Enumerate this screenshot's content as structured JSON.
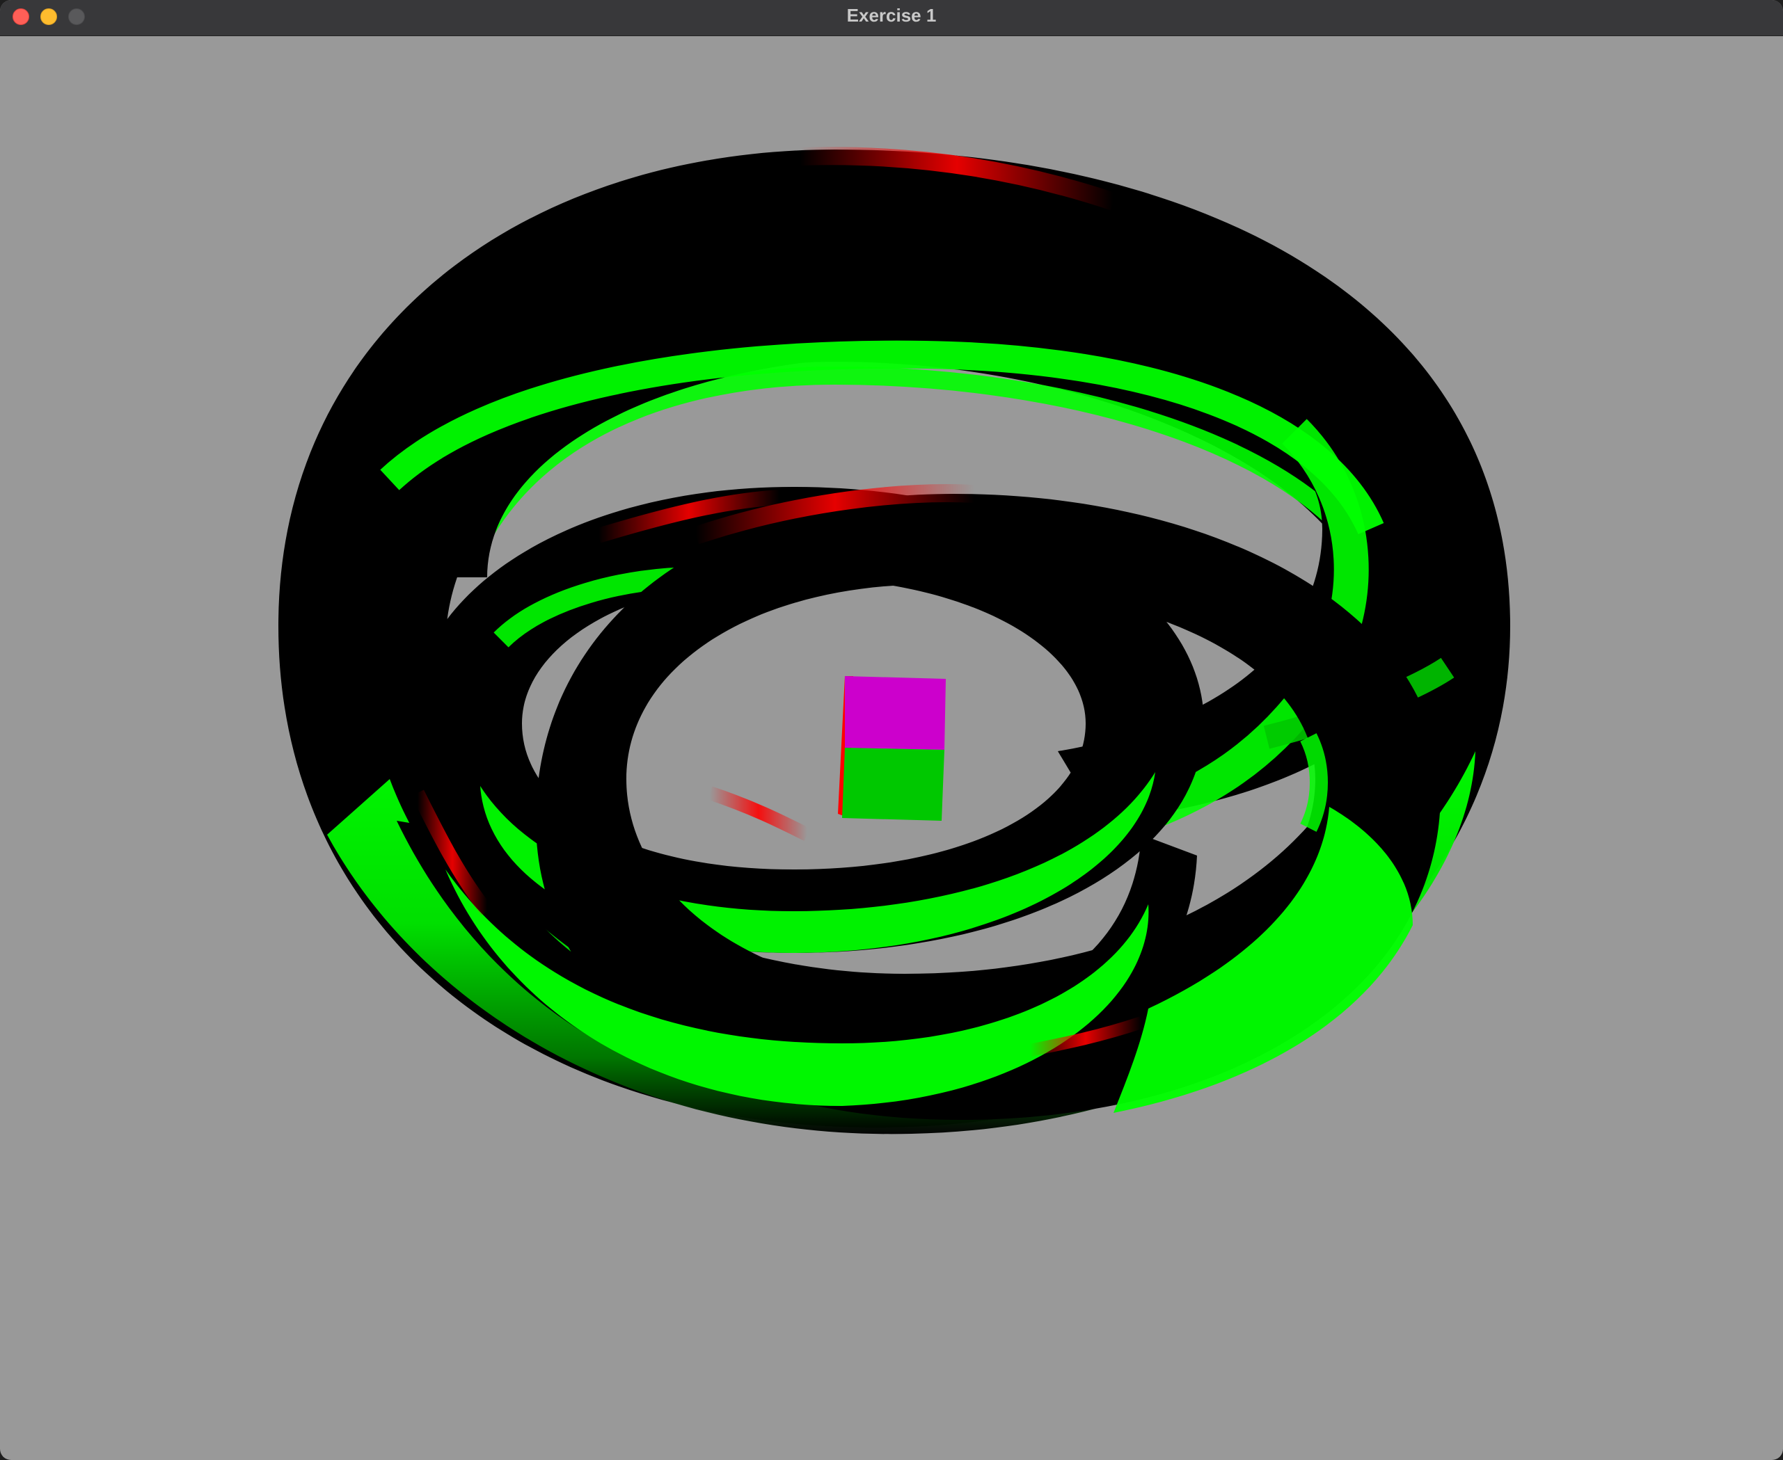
{
  "window": {
    "title": "Exercise 1"
  },
  "scene": {
    "background_color": "#999999",
    "ring_primary_color": "#00ff00",
    "ring_shadow_color": "#000000",
    "ring_highlight_color": "#ff0000",
    "cube_top_color": "#cc00cc",
    "cube_front_color": "#00c800",
    "cube_side_color": "#ff0000"
  },
  "icons": {
    "close": "close-icon",
    "minimize": "minimize-icon",
    "zoom": "zoom-icon"
  }
}
